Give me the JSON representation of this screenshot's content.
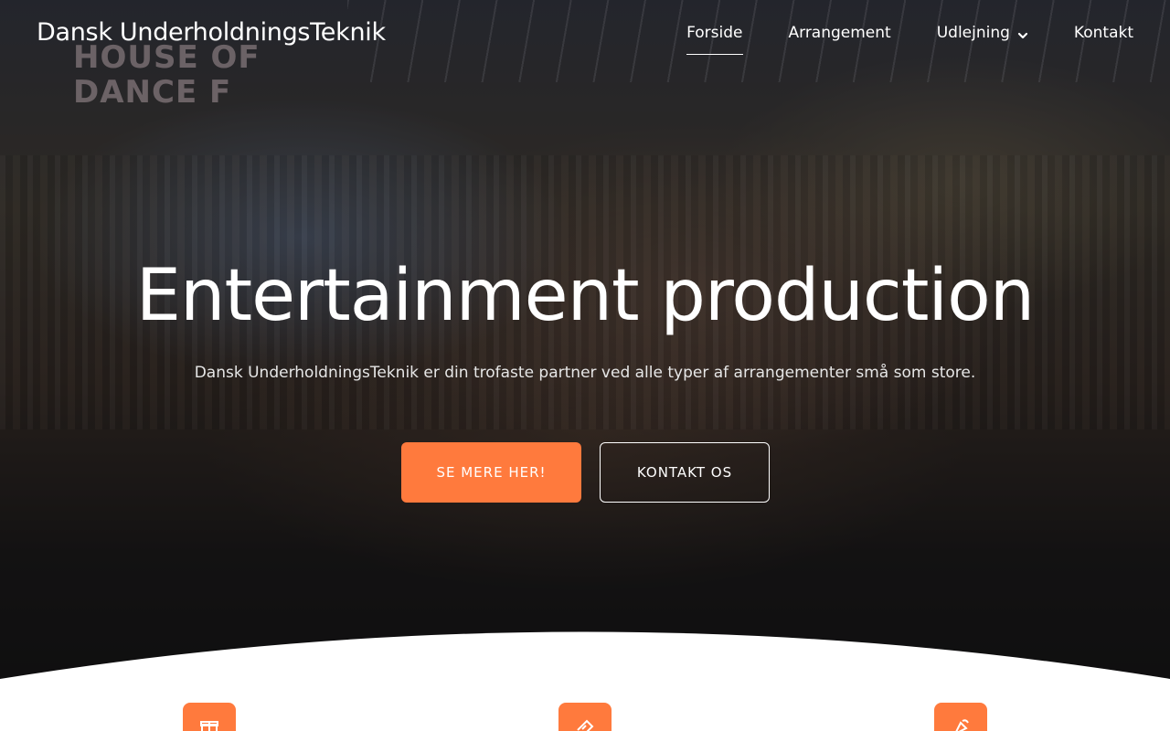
{
  "site": {
    "logo": "Dansk UnderholdningsTeknik"
  },
  "nav": {
    "items": [
      {
        "label": "Forside",
        "active": true
      },
      {
        "label": "Arrangement",
        "active": false
      },
      {
        "label": "Udlejning",
        "active": false,
        "has_dropdown": true
      },
      {
        "label": "Kontakt",
        "active": false
      }
    ]
  },
  "hero": {
    "background_sign": "HOUSE OF\nDANCE F",
    "title": "Entertainment production",
    "subtitle": "Dansk UnderholdningsTeknik er din trofaste partner ved alle typer af arrangementer små som store.",
    "primary_button": "SE MERE HER!",
    "secondary_button": "KONTAKT OS"
  },
  "features": {
    "icons": [
      "gift-icon",
      "ticket-icon",
      "party-popper-icon"
    ]
  },
  "colors": {
    "accent": "#ff7a3d",
    "text_light": "#ffffff"
  }
}
